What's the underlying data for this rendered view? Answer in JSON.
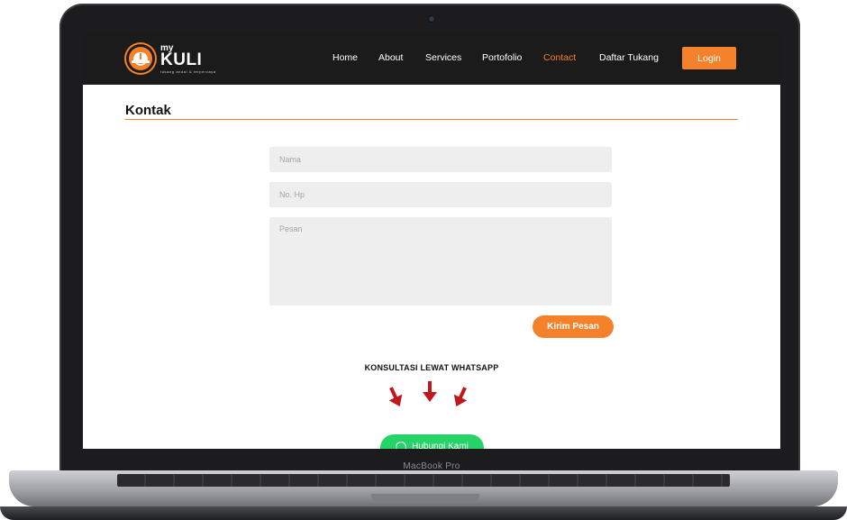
{
  "device": {
    "label": "MacBook Pro"
  },
  "brand": {
    "prefix": "my",
    "name": "KULI",
    "tagline": "tukang andal & terpercaya"
  },
  "nav": {
    "items": [
      {
        "label": "Home"
      },
      {
        "label": "About"
      },
      {
        "label": "Services"
      },
      {
        "label": "Portofolio"
      },
      {
        "label": "Contact",
        "active": true
      },
      {
        "label": "Daftar Tukang"
      }
    ],
    "login_label": "Login"
  },
  "contact": {
    "title": "Kontak",
    "name_placeholder": "Nama",
    "phone_placeholder": "No. Hp",
    "message_placeholder": "Pesan",
    "submit_label": "Kirim Pesan"
  },
  "whatsapp": {
    "heading": "KONSULTASI LEWAT WHATSAPP",
    "button_label": "Hubungi Kami"
  },
  "colors": {
    "accent": "#f5812a",
    "navbar": "#1b1b1b",
    "whatsapp": "#25d366",
    "arrow": "#c0161c"
  },
  "icons": [
    "helmet-logo-icon",
    "arrow-down-left-icon",
    "arrow-down-icon",
    "arrow-down-right-icon",
    "whatsapp-icon"
  ]
}
